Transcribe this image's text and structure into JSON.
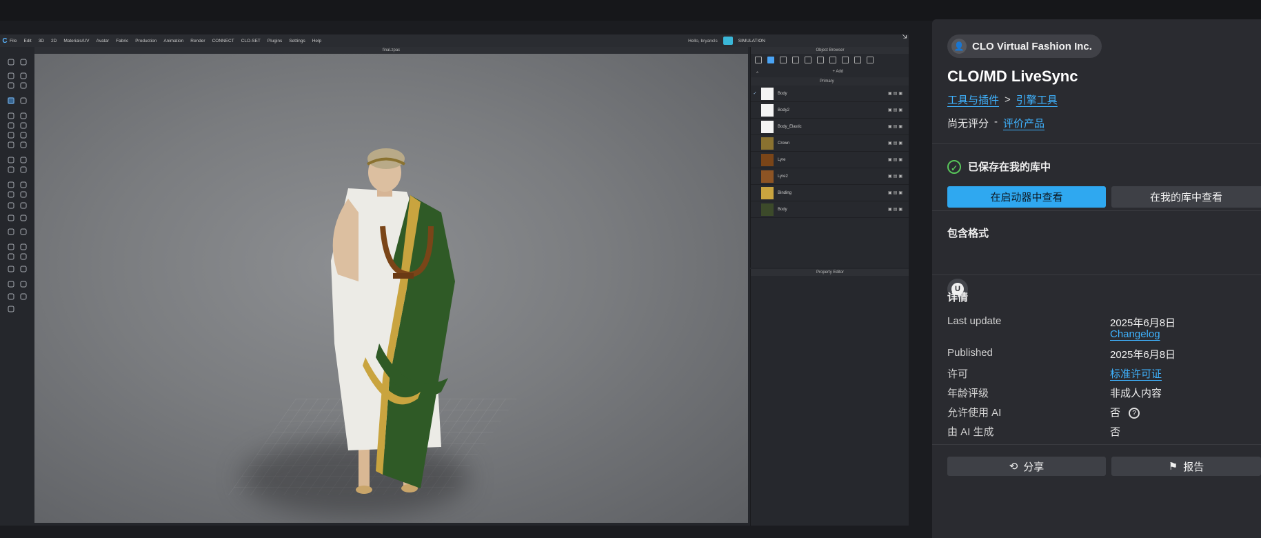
{
  "app": {
    "menu": [
      "File",
      "Edit",
      "3D",
      "2D",
      "Materials/UV",
      "Avatar",
      "Fabric",
      "Production",
      "Animation",
      "Render",
      "CONNECT",
      "CLO-SET",
      "Plugins",
      "Settings",
      "Help"
    ],
    "greeting": "Hello, bryancls",
    "sim_label": "SIMULATION",
    "doc_title": "final.zpac",
    "object_browser_title": "Object Browser",
    "property_editor_title": "Property Editor",
    "add_label": "+ Add",
    "primary_label": "Primary",
    "fabrics": [
      {
        "name": "Body",
        "color": "#f4f4f4"
      },
      {
        "name": "Body2",
        "color": "#f4f4f4"
      },
      {
        "name": "Body_Elastic",
        "color": "#f4f4f4"
      },
      {
        "name": "Crown",
        "color": "#8a7230"
      },
      {
        "name": "Lyre",
        "color": "#7a4518"
      },
      {
        "name": "Lyre2",
        "color": "#8d5424"
      },
      {
        "name": "Binding",
        "color": "#c9a43f"
      },
      {
        "name": "Body",
        "color": "#3c4a2a"
      }
    ]
  },
  "info": {
    "publisher": "CLO Virtual Fashion Inc.",
    "title": "CLO/MD LiveSync",
    "crumb1": "工具与插件",
    "crumb2": "引擎工具",
    "crumb_sep": ">",
    "no_rating": "尚无评分",
    "dash": "-",
    "rate_link": "评价产品",
    "saved_text": "已保存在我的库中",
    "btn_launcher": "在启动器中查看",
    "btn_library": "在我的库中查看",
    "formats_title": "包含格式",
    "format_icon_glyph": "U",
    "details_title": "详情",
    "last_update_label": "Last update",
    "last_update_value": "2025年6月8日",
    "changelog": "Changelog",
    "published_label": "Published",
    "published_value": "2025年6月8日",
    "license_label": "许可",
    "license_value": "标准许可证",
    "age_label": "年龄评级",
    "age_value": "非成人内容",
    "ai_allowed_label": "允许使用 AI",
    "ai_allowed_value": "否",
    "ai_generated_label": "由 AI 生成",
    "ai_generated_value": "否",
    "share": "分享",
    "report": "报告"
  },
  "colors": {
    "accent": "#2fa8f0",
    "link": "#3fb3ff",
    "success": "#58c65a",
    "panel": "#2a2b30"
  }
}
